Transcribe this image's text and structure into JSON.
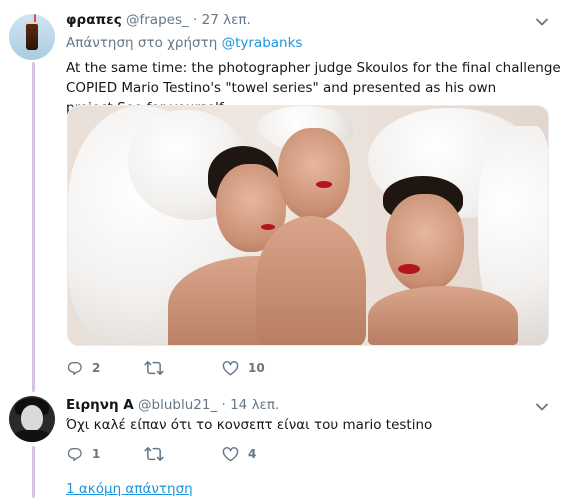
{
  "tweet": {
    "display_name": "φραπες",
    "handle": "@frapes_",
    "separator": "·",
    "time": "27 λεπ.",
    "reply_prefix": "Απάντηση στο χρήστη",
    "reply_mention": "@tyrabanks",
    "text": "At the same time: the photographer judge Skoulos for the final challenge COPIED Mario Testino's \"towel series\" and presented as his own project.See for yourself",
    "actions": {
      "reply_count": "2",
      "retweet_count": "",
      "like_count": "10"
    }
  },
  "reply": {
    "display_name": "Ειρηνη Α",
    "handle": "@blublu21_",
    "separator": "·",
    "time": "14 λεπ.",
    "text": "Όχι καλέ είπαν ότι το κονσεπτ είναι του mario testino",
    "actions": {
      "reply_count": "1",
      "retweet_count": "",
      "like_count": "4"
    }
  },
  "more_replies_link": "1 ακόμη απάντηση",
  "colors": {
    "accent": "#1b95e0",
    "muted": "#657786",
    "thread_line": "#d7c3e3"
  },
  "icons": [
    "reply-icon",
    "retweet-icon",
    "like-icon",
    "chevron-down-icon"
  ]
}
